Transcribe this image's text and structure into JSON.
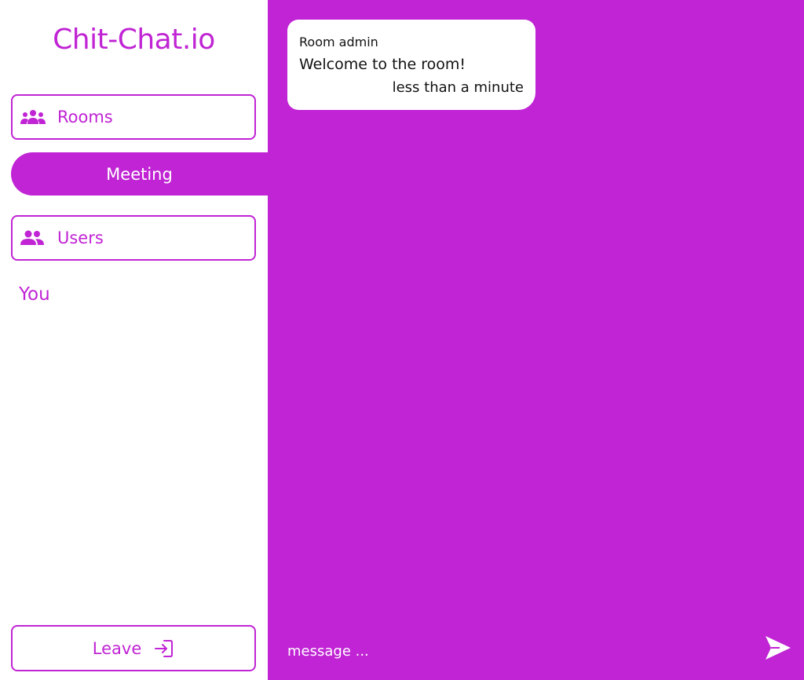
{
  "app": {
    "title": "Chit-Chat.io"
  },
  "sidebar": {
    "rooms_label": "Rooms",
    "active_room": "Meeting",
    "users_label": "Users",
    "users": [
      {
        "name": "You"
      }
    ],
    "leave_label": "Leave"
  },
  "chat": {
    "messages": [
      {
        "sender": "Room admin",
        "text": "Welcome to the room!",
        "time": "less than a minute"
      }
    ],
    "input_placeholder": "message ..."
  },
  "icons": {
    "rooms": "groups-icon",
    "users": "people-icon",
    "leave": "login-arrow-icon",
    "send": "send-icon"
  },
  "colors": {
    "accent": "#c024d4",
    "bubble": "#ffffff"
  }
}
